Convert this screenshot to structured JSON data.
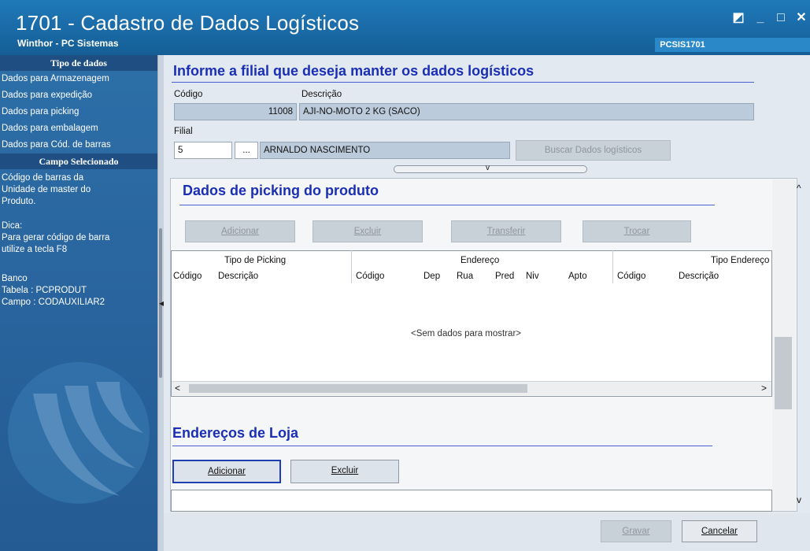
{
  "window": {
    "title": "1701 - Cadastro de Dados Logísticos",
    "subtitle": "Winthor - PC Sistemas",
    "form_code": "PCSIS1701",
    "controls": {
      "restore": "◩",
      "minimize": "_",
      "maximize": "□",
      "close": "✕"
    }
  },
  "sidebar": {
    "section1_title": "Tipo de dados",
    "items": [
      {
        "label": "Dados para Armazenagem"
      },
      {
        "label": "Dados para expedição"
      },
      {
        "label": "Dados para picking"
      },
      {
        "label": "Dados para embalagem"
      },
      {
        "label": "Dados para Cód. de barras"
      }
    ],
    "section2_title": "Campo Selecionado",
    "field_desc": "Código de barras da Unidade de master do Produto.",
    "tip_label": "Dica:",
    "tip_text": "Para gerar código de barra utilize a tecla F8",
    "db_label": "Banco",
    "db_table": "Tabela : PCPRODUT",
    "db_field": "Campo : CODAUXILIAR2",
    "logo_icon": "winthor-logo-icon"
  },
  "header": {
    "title": "Informe a filial que deseja manter os dados logísticos",
    "codigo_label": "Código",
    "descricao_label": "Descrição",
    "codigo_value": "11008",
    "descricao_value": "AJI-NO-MOTO 2 KG (SACO)",
    "filial_label": "Filial",
    "filial_value": "5",
    "lookup_label": "...",
    "filial_name": "ARNALDO NASCIMENTO",
    "buscar_button": "Buscar Dados logísticos",
    "collapse_icon": "chevron-down-icon"
  },
  "picking": {
    "title": "Dados de picking do produto",
    "buttons": {
      "adicionar": "Adicionar",
      "excluir": "Excluir",
      "transferir": "Transferir",
      "trocar": "Trocar"
    },
    "group_headers": {
      "tipo_picking": "Tipo de Picking",
      "endereco": "Endereço",
      "tipo_endereco": "Tipo Endereço"
    },
    "columns": [
      "Código",
      "Descrição",
      "Código",
      "Dep",
      "Rua",
      "Pred",
      "Niv",
      "Apto",
      "Código",
      "Descrição"
    ],
    "empty_text": "<Sem dados para mostrar>",
    "scroll_left": "<",
    "scroll_right": ">"
  },
  "lojas": {
    "title": "Endereços de Loja",
    "buttons": {
      "adicionar": "Adicionar",
      "excluir": "Excluir"
    }
  },
  "scroll": {
    "up": "^",
    "down": "v"
  },
  "footer": {
    "gravar": "Gravar",
    "cancelar": "Cancelar"
  },
  "colors": {
    "title_bar": "#1a6aa6",
    "heading": "#1a2fb3",
    "sidebar": "#2a66a0"
  }
}
